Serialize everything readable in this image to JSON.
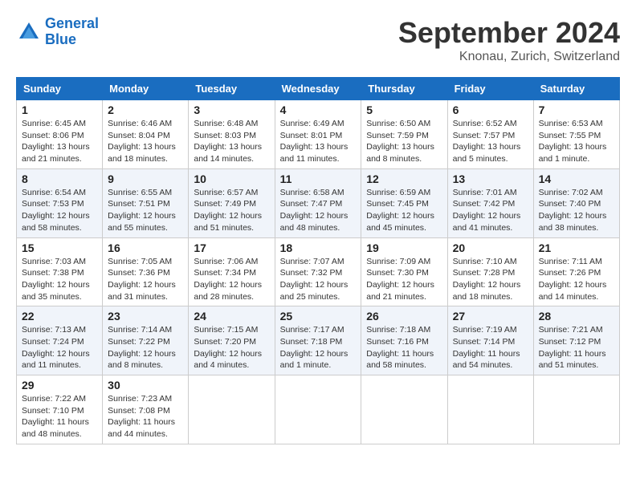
{
  "logo": {
    "text1": "General",
    "text2": "Blue"
  },
  "title": "September 2024",
  "location": "Knonau, Zurich, Switzerland",
  "weekdays": [
    "Sunday",
    "Monday",
    "Tuesday",
    "Wednesday",
    "Thursday",
    "Friday",
    "Saturday"
  ],
  "weeks": [
    [
      {
        "day": "1",
        "sunrise": "Sunrise: 6:45 AM",
        "sunset": "Sunset: 8:06 PM",
        "daylight": "Daylight: 13 hours and 21 minutes."
      },
      {
        "day": "2",
        "sunrise": "Sunrise: 6:46 AM",
        "sunset": "Sunset: 8:04 PM",
        "daylight": "Daylight: 13 hours and 18 minutes."
      },
      {
        "day": "3",
        "sunrise": "Sunrise: 6:48 AM",
        "sunset": "Sunset: 8:03 PM",
        "daylight": "Daylight: 13 hours and 14 minutes."
      },
      {
        "day": "4",
        "sunrise": "Sunrise: 6:49 AM",
        "sunset": "Sunset: 8:01 PM",
        "daylight": "Daylight: 13 hours and 11 minutes."
      },
      {
        "day": "5",
        "sunrise": "Sunrise: 6:50 AM",
        "sunset": "Sunset: 7:59 PM",
        "daylight": "Daylight: 13 hours and 8 minutes."
      },
      {
        "day": "6",
        "sunrise": "Sunrise: 6:52 AM",
        "sunset": "Sunset: 7:57 PM",
        "daylight": "Daylight: 13 hours and 5 minutes."
      },
      {
        "day": "7",
        "sunrise": "Sunrise: 6:53 AM",
        "sunset": "Sunset: 7:55 PM",
        "daylight": "Daylight: 13 hours and 1 minute."
      }
    ],
    [
      {
        "day": "8",
        "sunrise": "Sunrise: 6:54 AM",
        "sunset": "Sunset: 7:53 PM",
        "daylight": "Daylight: 12 hours and 58 minutes."
      },
      {
        "day": "9",
        "sunrise": "Sunrise: 6:55 AM",
        "sunset": "Sunset: 7:51 PM",
        "daylight": "Daylight: 12 hours and 55 minutes."
      },
      {
        "day": "10",
        "sunrise": "Sunrise: 6:57 AM",
        "sunset": "Sunset: 7:49 PM",
        "daylight": "Daylight: 12 hours and 51 minutes."
      },
      {
        "day": "11",
        "sunrise": "Sunrise: 6:58 AM",
        "sunset": "Sunset: 7:47 PM",
        "daylight": "Daylight: 12 hours and 48 minutes."
      },
      {
        "day": "12",
        "sunrise": "Sunrise: 6:59 AM",
        "sunset": "Sunset: 7:45 PM",
        "daylight": "Daylight: 12 hours and 45 minutes."
      },
      {
        "day": "13",
        "sunrise": "Sunrise: 7:01 AM",
        "sunset": "Sunset: 7:42 PM",
        "daylight": "Daylight: 12 hours and 41 minutes."
      },
      {
        "day": "14",
        "sunrise": "Sunrise: 7:02 AM",
        "sunset": "Sunset: 7:40 PM",
        "daylight": "Daylight: 12 hours and 38 minutes."
      }
    ],
    [
      {
        "day": "15",
        "sunrise": "Sunrise: 7:03 AM",
        "sunset": "Sunset: 7:38 PM",
        "daylight": "Daylight: 12 hours and 35 minutes."
      },
      {
        "day": "16",
        "sunrise": "Sunrise: 7:05 AM",
        "sunset": "Sunset: 7:36 PM",
        "daylight": "Daylight: 12 hours and 31 minutes."
      },
      {
        "day": "17",
        "sunrise": "Sunrise: 7:06 AM",
        "sunset": "Sunset: 7:34 PM",
        "daylight": "Daylight: 12 hours and 28 minutes."
      },
      {
        "day": "18",
        "sunrise": "Sunrise: 7:07 AM",
        "sunset": "Sunset: 7:32 PM",
        "daylight": "Daylight: 12 hours and 25 minutes."
      },
      {
        "day": "19",
        "sunrise": "Sunrise: 7:09 AM",
        "sunset": "Sunset: 7:30 PM",
        "daylight": "Daylight: 12 hours and 21 minutes."
      },
      {
        "day": "20",
        "sunrise": "Sunrise: 7:10 AM",
        "sunset": "Sunset: 7:28 PM",
        "daylight": "Daylight: 12 hours and 18 minutes."
      },
      {
        "day": "21",
        "sunrise": "Sunrise: 7:11 AM",
        "sunset": "Sunset: 7:26 PM",
        "daylight": "Daylight: 12 hours and 14 minutes."
      }
    ],
    [
      {
        "day": "22",
        "sunrise": "Sunrise: 7:13 AM",
        "sunset": "Sunset: 7:24 PM",
        "daylight": "Daylight: 12 hours and 11 minutes."
      },
      {
        "day": "23",
        "sunrise": "Sunrise: 7:14 AM",
        "sunset": "Sunset: 7:22 PM",
        "daylight": "Daylight: 12 hours and 8 minutes."
      },
      {
        "day": "24",
        "sunrise": "Sunrise: 7:15 AM",
        "sunset": "Sunset: 7:20 PM",
        "daylight": "Daylight: 12 hours and 4 minutes."
      },
      {
        "day": "25",
        "sunrise": "Sunrise: 7:17 AM",
        "sunset": "Sunset: 7:18 PM",
        "daylight": "Daylight: 12 hours and 1 minute."
      },
      {
        "day": "26",
        "sunrise": "Sunrise: 7:18 AM",
        "sunset": "Sunset: 7:16 PM",
        "daylight": "Daylight: 11 hours and 58 minutes."
      },
      {
        "day": "27",
        "sunrise": "Sunrise: 7:19 AM",
        "sunset": "Sunset: 7:14 PM",
        "daylight": "Daylight: 11 hours and 54 minutes."
      },
      {
        "day": "28",
        "sunrise": "Sunrise: 7:21 AM",
        "sunset": "Sunset: 7:12 PM",
        "daylight": "Daylight: 11 hours and 51 minutes."
      }
    ],
    [
      {
        "day": "29",
        "sunrise": "Sunrise: 7:22 AM",
        "sunset": "Sunset: 7:10 PM",
        "daylight": "Daylight: 11 hours and 48 minutes."
      },
      {
        "day": "30",
        "sunrise": "Sunrise: 7:23 AM",
        "sunset": "Sunset: 7:08 PM",
        "daylight": "Daylight: 11 hours and 44 minutes."
      },
      null,
      null,
      null,
      null,
      null
    ]
  ]
}
